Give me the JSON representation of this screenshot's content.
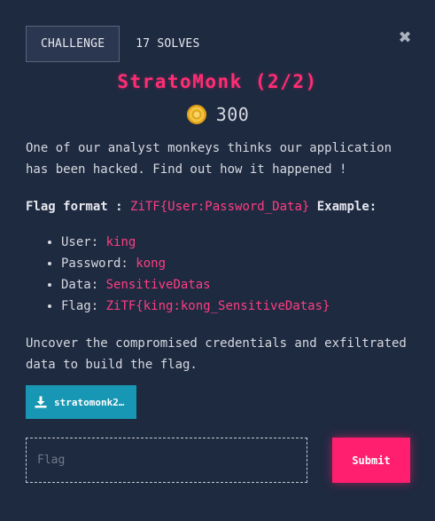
{
  "header": {
    "tab_challenge": "CHALLENGE",
    "tab_solves": "17 SOLVES",
    "close_icon": "close-icon"
  },
  "challenge": {
    "title": "StratoMonk (2/2)",
    "points": "300",
    "points_icon": "coin-icon"
  },
  "description": {
    "intro": "One of our analyst monkeys thinks our application has been hacked. Find out how it happened !",
    "flag_format_label": "Flag format :",
    "flag_format_value": "ZiTF{User:Password_Data}",
    "example_label": "Example:",
    "items": [
      {
        "label": "User:",
        "value": "king"
      },
      {
        "label": "Password:",
        "value": "kong"
      },
      {
        "label": "Data:",
        "value": "SensitiveDatas"
      },
      {
        "label": "Flag:",
        "value": "ZiTF{king:kong_SensitiveDatas}"
      }
    ],
    "outro": "Uncover the compromised credentials and exfiltrated data to build the flag."
  },
  "attachment": {
    "label": "stratomonk2…",
    "icon": "download-icon"
  },
  "form": {
    "placeholder": "Flag",
    "value": "",
    "submit_label": "Submit"
  },
  "colors": {
    "background": "#1e2a40",
    "accent": "#ff1f6e",
    "download": "#1797b3"
  }
}
